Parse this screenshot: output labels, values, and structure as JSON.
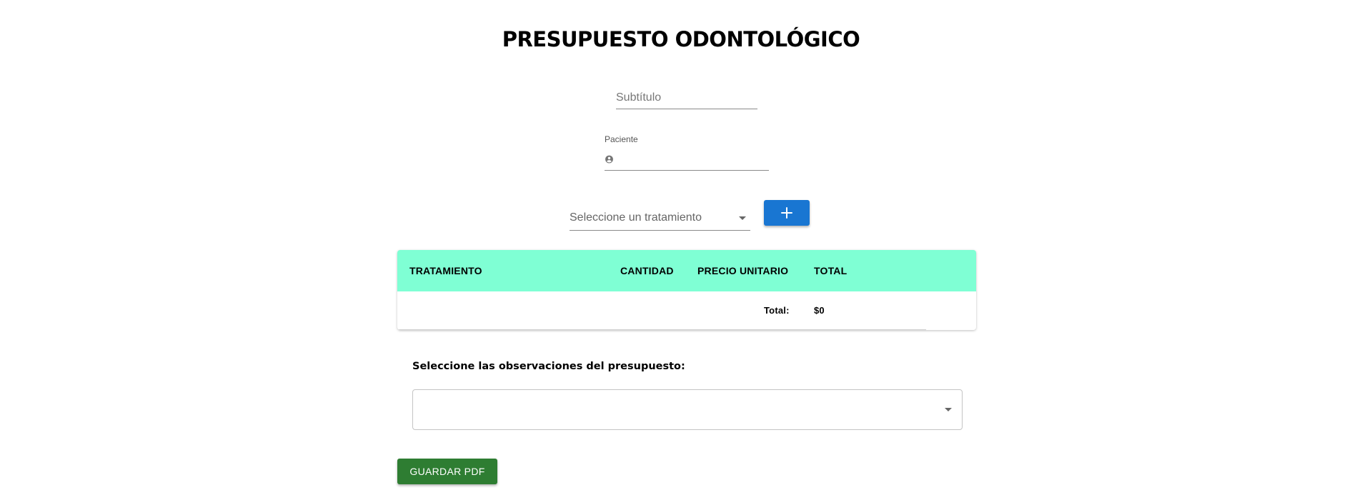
{
  "header": {
    "title": "PRESUPUESTO ODONTOLÓGICO"
  },
  "form": {
    "subtitle_placeholder": "Subtítulo",
    "subtitle_value": "",
    "patient_label": "Paciente",
    "patient_icon": "account-circle-icon",
    "patient_value": "",
    "treatment_placeholder": "Seleccione un tratamiento",
    "add_button_icon": "plus-icon"
  },
  "table": {
    "columns": [
      "TRATAMIENTO",
      "CANTIDAD",
      "PRECIO UNITARIO",
      "TOTAL"
    ],
    "rows": [],
    "total_label": "Total:",
    "total_value": "$0",
    "header_color": "#7fffd4"
  },
  "observations": {
    "label": "Seleccione las observaciones del presupuesto:",
    "selected": ""
  },
  "actions": {
    "save_label": "GUARDAR PDF",
    "save_color": "#2e7d32",
    "add_color": "#1976d2"
  }
}
